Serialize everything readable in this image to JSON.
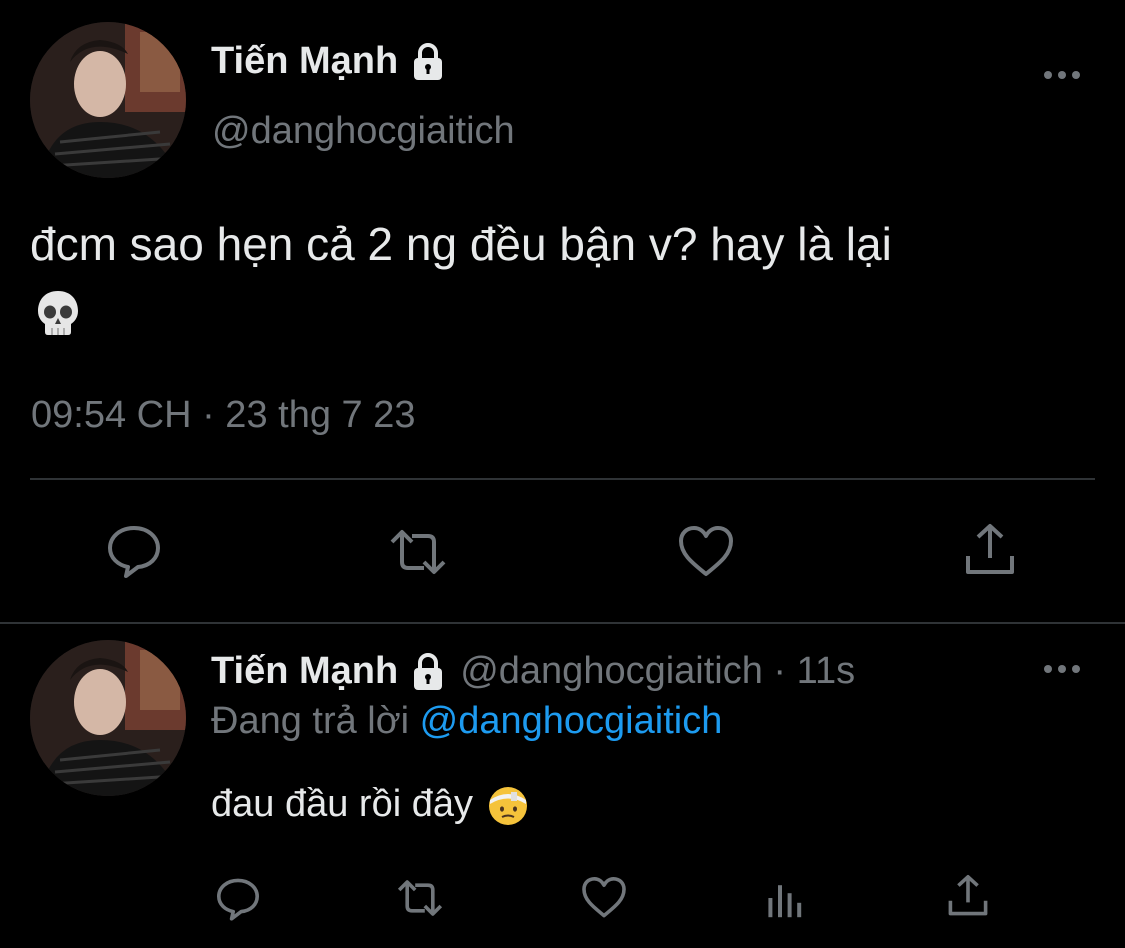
{
  "main_tweet": {
    "display_name": "Tiến Mạnh",
    "handle": "@danghocgiaitich",
    "text": "đcm sao hẹn cả 2 ng đều bận v? hay là lại",
    "emoji": "skull",
    "timestamp": "09:54 CH · 23 thg 7 23",
    "actions": [
      "reply-icon",
      "retweet-icon",
      "like-icon",
      "share-icon"
    ]
  },
  "reply_tweet": {
    "display_name": "Tiến Mạnh",
    "handle_time": "@danghocgiaitich · 11s",
    "replying_prefix": "Đang trả lời",
    "replying_to": "@danghocgiaitich",
    "text": "đau đầu rồi đây",
    "emoji": "face-with-head-bandage",
    "actions": [
      "reply-icon",
      "retweet-icon",
      "like-icon",
      "analytics-icon",
      "share-icon"
    ]
  },
  "colors": {
    "background": "#000000",
    "text": "#e7e9ea",
    "secondary": "#71767b",
    "accent": "#1d9bf0",
    "divider": "#2f3336"
  }
}
